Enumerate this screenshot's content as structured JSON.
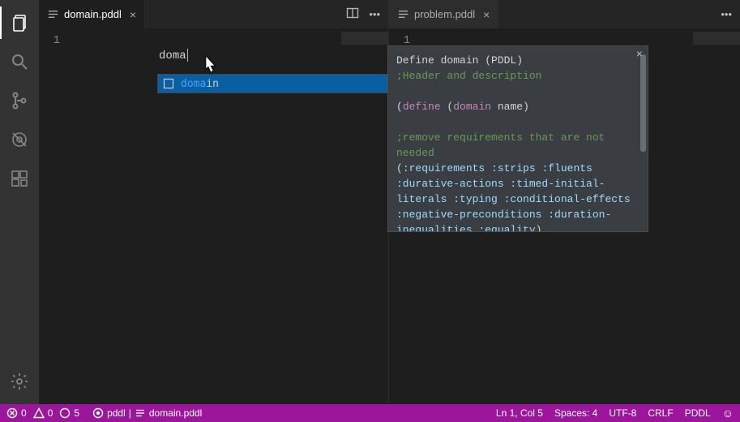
{
  "activity": {
    "items": [
      "explorer-icon",
      "search-icon",
      "source-control-icon",
      "debug-icon",
      "extensions-icon"
    ],
    "bottom": [
      "gear-icon"
    ]
  },
  "panes": {
    "left": {
      "tab_label": "domain.pddl",
      "line_number": "1",
      "typed_text": "doma"
    },
    "right": {
      "tab_label": "problem.pddl",
      "line_number": "1"
    }
  },
  "suggest": {
    "match": "doma",
    "rest": "in"
  },
  "docs": {
    "title": "Define domain (PDDL)",
    "l1": ";Header and description",
    "l2_a": "(",
    "l2_b": "define",
    "l2_c": " (",
    "l2_d": "domain",
    "l2_e": " name",
    "l2_f": ")",
    "l3": ";remove requirements that are not needed",
    "l4_open": "(",
    "l4": ":requirements :strips :fluents :durative-actions :timed-initial-literals :typing :conditional-effects :negative-preconditions :duration-inequalities :equality",
    "l4_close": ")"
  },
  "status": {
    "errors": "0",
    "warnings": "0",
    "infos": "5",
    "lang_left": "pddl",
    "file_left": "domain.pddl",
    "cursor": "Ln 1, Col 5",
    "indent": "Spaces: 4",
    "encoding": "UTF-8",
    "eol": "CRLF",
    "language": "PDDL"
  }
}
